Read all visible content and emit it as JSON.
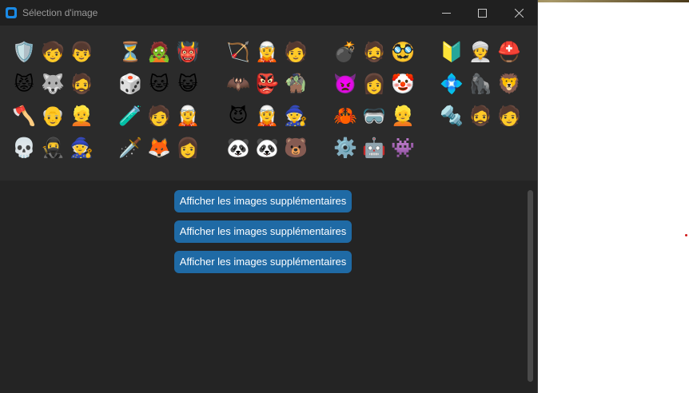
{
  "window": {
    "title": "Sélection d'image",
    "accent_color": "#1a8ae5"
  },
  "controls": {
    "minimize_icon": "minimize-icon",
    "maximize_icon": "maximize-icon",
    "close_icon": "close-icon"
  },
  "avatar_groups": [
    {
      "items": [
        {
          "icon": "emblem-icon",
          "glyph": "🛡️"
        },
        {
          "icon": "hero-face-icon",
          "glyph": "🧒"
        },
        {
          "icon": "hero-face-icon",
          "glyph": "👦"
        },
        {
          "icon": "horned-face-icon",
          "glyph": "😾"
        },
        {
          "icon": "masked-face-icon",
          "glyph": "🐺"
        },
        {
          "icon": "viking-face-icon",
          "glyph": "🧔"
        },
        {
          "icon": "axe-icon",
          "glyph": "🪓"
        },
        {
          "icon": "old-face-icon",
          "glyph": "👴"
        },
        {
          "icon": "blonde-face-icon",
          "glyph": "👱"
        },
        {
          "icon": "skull-icon",
          "glyph": "💀"
        },
        {
          "icon": "hooded-face-icon",
          "glyph": "🥷"
        },
        {
          "icon": "hooded-face-icon",
          "glyph": "🧙"
        }
      ]
    },
    {
      "items": [
        {
          "icon": "hourglass-icon",
          "glyph": "⏳"
        },
        {
          "icon": "mummy-face-icon",
          "glyph": "🧟"
        },
        {
          "icon": "monster-face-icon",
          "glyph": "👹"
        },
        {
          "icon": "dice-icon",
          "glyph": "🎲"
        },
        {
          "icon": "cat-mask-icon",
          "glyph": "🐱"
        },
        {
          "icon": "cat-mask-icon",
          "glyph": "😺"
        },
        {
          "icon": "potion-icon",
          "glyph": "🧪"
        },
        {
          "icon": "face-icon",
          "glyph": "🧑"
        },
        {
          "icon": "elf-face-icon",
          "glyph": "🧝"
        },
        {
          "icon": "sword-icon",
          "glyph": "🗡️"
        },
        {
          "icon": "fox-face-icon",
          "glyph": "🦊"
        },
        {
          "icon": "red-haired-face-icon",
          "glyph": "👩"
        }
      ]
    },
    {
      "items": [
        {
          "icon": "arrow-icon",
          "glyph": "🏹"
        },
        {
          "icon": "orange-elf-icon",
          "glyph": "🧝"
        },
        {
          "icon": "orange-elf-icon",
          "glyph": "🧑"
        },
        {
          "icon": "bat-face-icon",
          "glyph": "🦇"
        },
        {
          "icon": "goblin-face-icon",
          "glyph": "👺"
        },
        {
          "icon": "goblin-face-icon",
          "glyph": "🧌"
        },
        {
          "icon": "devil-face-icon",
          "glyph": "😈"
        },
        {
          "icon": "green-elf-icon",
          "glyph": "🧝"
        },
        {
          "icon": "green-elf-icon",
          "glyph": "🧙"
        },
        {
          "icon": "panda-mask-icon",
          "glyph": "🐼"
        },
        {
          "icon": "panda-face-icon",
          "glyph": "🐼"
        },
        {
          "icon": "panda-face-icon",
          "glyph": "🐻"
        }
      ]
    },
    {
      "items": [
        {
          "icon": "bomb-icon",
          "glyph": "💣"
        },
        {
          "icon": "bearded-face-icon",
          "glyph": "🧔"
        },
        {
          "icon": "bearded-face-icon",
          "glyph": "🥸"
        },
        {
          "icon": "demon-face-icon",
          "glyph": "👿"
        },
        {
          "icon": "red-haired-face-icon",
          "glyph": "👩"
        },
        {
          "icon": "clown-face-icon",
          "glyph": "🤡"
        },
        {
          "icon": "crab-emblem-icon",
          "glyph": "🦀"
        },
        {
          "icon": "goggles-face-icon",
          "glyph": "🥽"
        },
        {
          "icon": "blonde-face-icon",
          "glyph": "👱"
        },
        {
          "icon": "gear-ring-icon",
          "glyph": "⚙️"
        },
        {
          "icon": "robot-face-icon",
          "glyph": "🤖"
        },
        {
          "icon": "robot-face-icon",
          "glyph": "👾"
        }
      ]
    },
    {
      "items": [
        {
          "icon": "wing-emblem-icon",
          "glyph": "🔰"
        },
        {
          "icon": "white-face-icon",
          "glyph": "👳"
        },
        {
          "icon": "winged-helm-icon",
          "glyph": "⛑️"
        },
        {
          "icon": "gem-emblem-icon",
          "glyph": "💠"
        },
        {
          "icon": "ape-face-icon",
          "glyph": "🦍"
        },
        {
          "icon": "lion-face-icon",
          "glyph": "🦁"
        },
        {
          "icon": "drill-icon",
          "glyph": "🔩"
        },
        {
          "icon": "monk-face-icon",
          "glyph": "🧔"
        },
        {
          "icon": "monk-face-icon",
          "glyph": "🧑"
        }
      ]
    }
  ],
  "buttons": [
    {
      "label": "Afficher les images supplémentaires"
    },
    {
      "label": "Afficher les images supplémentaires"
    },
    {
      "label": "Afficher les images supplémentaires"
    }
  ],
  "colors": {
    "button_bg": "#1f6aa5",
    "window_bg": "#242424",
    "panel_bg": "#2b2b2b"
  }
}
